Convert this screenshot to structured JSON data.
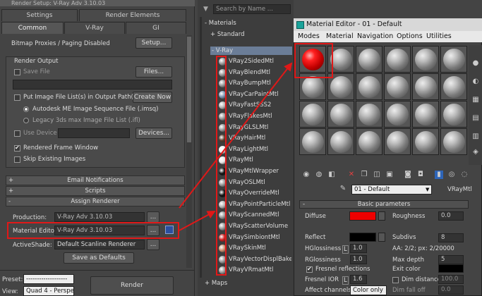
{
  "render_setup": {
    "title": "Render Setup: V-Ray Adv 3.10.03",
    "tabs_top": [
      "Settings",
      "Render Elements"
    ],
    "tabs_bottom": [
      "Common",
      "V-Ray",
      "GI"
    ],
    "bitmap_proxies": "Bitmap Proxies / Paging Disabled",
    "setup_btn": "Setup...",
    "render_output_label": "Render Output",
    "save_file": "Save File",
    "files_btn": "Files...",
    "put_image": "Put Image File List(s) in Output Path(s)",
    "create_now": "Create Now",
    "autodesk_seq": "Autodesk ME Image Sequence File (.imsq)",
    "legacy_list": "Legacy 3ds max Image File List (.ifl)",
    "use_device": "Use Device",
    "devices_btn": "Devices...",
    "rendered_frame": "Rendered Frame Window",
    "skip_existing": "Skip Existing Images",
    "rollups": [
      "Email Notifications",
      "Scripts",
      "Assign Renderer"
    ],
    "production_label": "Production:",
    "production_value": "V-Ray Adv 3.10.03",
    "material_editor_label": "Material Editor:",
    "material_editor_value": "V-Ray Adv 3.10.03",
    "activeshade_label": "ActiveShade:",
    "activeshade_value": "Default Scanline Renderer",
    "dots": "...",
    "save_defaults": "Save as Defaults",
    "preset_label": "Preset:",
    "preset_value": "-------------------",
    "view_label": "View:",
    "view_value": "Quad 4 - Perspe",
    "render_btn": "Render"
  },
  "browser": {
    "search": "Search by Name ...",
    "materials": "Materials",
    "standard": "+ Standard",
    "vray": "- V-Ray",
    "maps": "+ Maps",
    "items": [
      {
        "name": "VRay2SidedMtl",
        "color": "#9a9a9a"
      },
      {
        "name": "VRayBlendMtl",
        "color": "#9a9a9a"
      },
      {
        "name": "VRayBumpMtl",
        "color": "#9a9a9a"
      },
      {
        "name": "VRayCarPaintMtl",
        "color": "#7f97b4"
      },
      {
        "name": "VRayFastSSS2",
        "color": "#b5b5b5"
      },
      {
        "name": "VRayFlakesMtl",
        "color": "#9a9a9a"
      },
      {
        "name": "VRayGLSLMtl",
        "color": "#9a9a9a"
      },
      {
        "name": "VRayHairMtl",
        "color": "#5a4030"
      },
      {
        "name": "VRayLightMtl",
        "color": "#f0f0f0"
      },
      {
        "name": "VRayMtl",
        "color": "#e8e8e8"
      },
      {
        "name": "VRayMtlWrapper",
        "color": "#111111"
      },
      {
        "name": "VRayOSLMtl",
        "color": "#9a9a9a"
      },
      {
        "name": "VRayOverrideMtl",
        "color": "#111111"
      },
      {
        "name": "VRayPointParticleMtl",
        "color": "#b5b5b5"
      },
      {
        "name": "VRayScannedMtl",
        "color": "#9a9a9a"
      },
      {
        "name": "VRayScatterVolume",
        "color": "#9a9a9a"
      },
      {
        "name": "VRaySimbiontMtl",
        "color": "#cc2020"
      },
      {
        "name": "VRaySkinMtl",
        "color": "#c89070"
      },
      {
        "name": "VRayVectorDisplBake",
        "color": "#9a9a9a"
      },
      {
        "name": "VRayVRmatMtl",
        "color": "#9a9a9a"
      }
    ]
  },
  "material_editor": {
    "title": "Material Editor - 01 - Default",
    "menu": [
      "Modes",
      "Material",
      "Navigation",
      "Options",
      "Utilities"
    ],
    "material_name": "01 - Default",
    "material_type": "VRayMtl",
    "basic_params": "Basic parameters",
    "diffuse": "Diffuse",
    "roughness": "Roughness",
    "roughness_val": "0.0",
    "reflect": "Reflect",
    "subdivs": "Subdivs",
    "subdivs_val": "8",
    "hgloss": "HGlossiness",
    "hgloss_val": "1.0",
    "aa": "AA: 2/2; px: 2/20000",
    "rgloss": "RGlossiness",
    "rgloss_val": "1.0",
    "max_depth": "Max depth",
    "max_depth_val": "5",
    "fresnel": "Fresnel reflections",
    "exit_color": "Exit color",
    "fresnel_ior": "Fresnel IOR",
    "fresnel_ior_val": "1.6",
    "dim_distance": "Dim distance",
    "dim_distance_val": "100.0",
    "affect_channels": "Affect channels",
    "affect_value": "Color only",
    "dim_falloff": "Dim fall off",
    "dim_falloff_val": "0.0",
    "L": "L",
    "diffuse_color": "#ee0000"
  }
}
